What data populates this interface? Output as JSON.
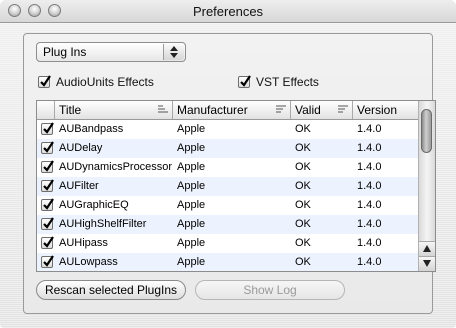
{
  "window": {
    "title": "Preferences"
  },
  "popup": {
    "selected": "Plug Ins"
  },
  "filters": {
    "audiounits": {
      "label": "AudioUnits Effects",
      "checked": true
    },
    "vst": {
      "label": "VST Effects",
      "checked": true
    }
  },
  "table": {
    "columns": [
      "Title",
      "Manufacturer",
      "Valid",
      "Version"
    ],
    "rows": [
      {
        "title": "AUBandpass",
        "manufacturer": "Apple",
        "valid": "OK",
        "version": "1.4.0"
      },
      {
        "title": "AUDelay",
        "manufacturer": "Apple",
        "valid": "OK",
        "version": "1.4.0"
      },
      {
        "title": "AUDynamicsProcessor",
        "manufacturer": "Apple",
        "valid": "OK",
        "version": "1.4.0"
      },
      {
        "title": "AUFilter",
        "manufacturer": "Apple",
        "valid": "OK",
        "version": "1.4.0"
      },
      {
        "title": "AUGraphicEQ",
        "manufacturer": "Apple",
        "valid": "OK",
        "version": "1.4.0"
      },
      {
        "title": "AUHighShelfFilter",
        "manufacturer": "Apple",
        "valid": "OK",
        "version": "1.4.0"
      },
      {
        "title": "AUHipass",
        "manufacturer": "Apple",
        "valid": "OK",
        "version": "1.4.0"
      },
      {
        "title": "AULowpass",
        "manufacturer": "Apple",
        "valid": "OK",
        "version": "1.4.0"
      }
    ]
  },
  "buttons": {
    "rescan": "Rescan selected PlugIns",
    "showlog": "Show Log"
  }
}
